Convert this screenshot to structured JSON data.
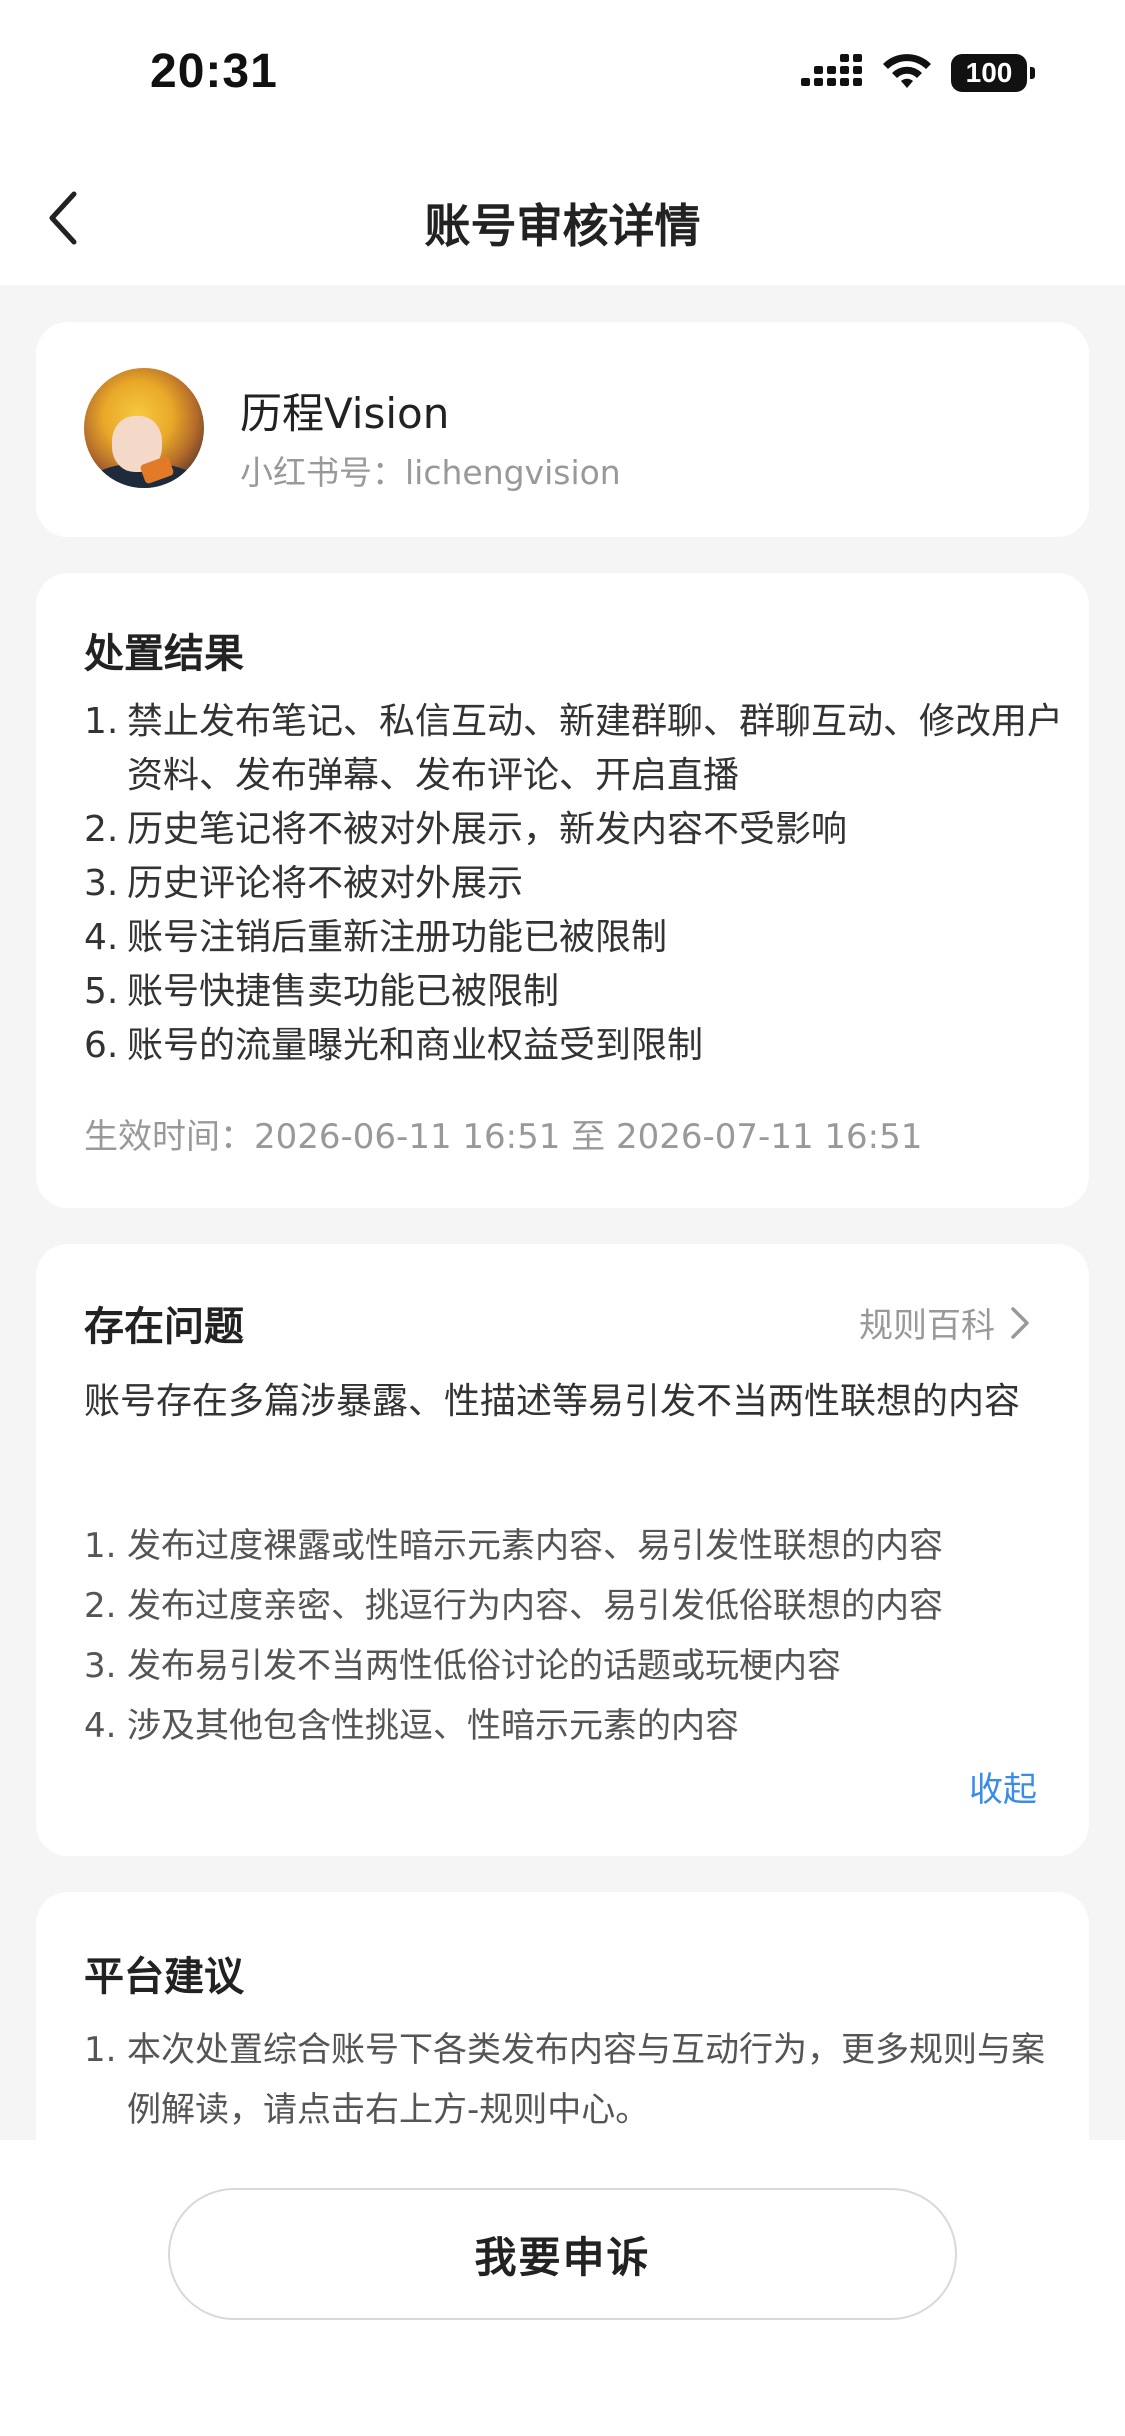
{
  "status_bar": {
    "time": "20:31",
    "battery": "100"
  },
  "header": {
    "title": "账号审核详情",
    "back_icon": "chevron-left-icon"
  },
  "profile": {
    "name": "历程Vision",
    "id_line": "小红书号：lichengvision"
  },
  "result": {
    "title": "处置结果",
    "items": [
      {
        "num": "1.",
        "text": "禁止发布笔记、私信互动、新建群聊、群聊互动、修改用户资料、发布弹幕、发布评论、开启直播"
      },
      {
        "num": "2.",
        "text": "历史笔记将不被对外展示，新发内容不受影响"
      },
      {
        "num": "3.",
        "text": "历史评论将不被对外展示"
      },
      {
        "num": "4.",
        "text": "账号注销后重新注册功能已被限制"
      },
      {
        "num": "5.",
        "text": "账号快捷售卖功能已被限制"
      },
      {
        "num": "6.",
        "text": "账号的流量曝光和商业权益受到限制"
      }
    ],
    "effective_time": "生效时间：2026-06-11 16:51 至 2026-07-11 16:51"
  },
  "problem": {
    "title": "存在问题",
    "rules_link": "规则百科",
    "summary": "账号存在多篇涉暴露、性描述等易引发不当两性联想的内容",
    "items": [
      {
        "num": "1.",
        "text": "发布过度裸露或性暗示元素内容、易引发性联想的内容"
      },
      {
        "num": "2.",
        "text": "发布过度亲密、挑逗行为内容、易引发低俗联想的内容"
      },
      {
        "num": "3.",
        "text": "发布易引发不当两性低俗讨论的话题或玩梗内容"
      },
      {
        "num": "4.",
        "text": "涉及其他包含性挑逗、性暗示元素的内容"
      }
    ],
    "collapse_label": "收起"
  },
  "advice": {
    "title": "平台建议",
    "items": [
      {
        "num": "1.",
        "text": "本次处置综合账号下各类发布内容与互动行为，更多规则与案例解读，请点击右上方-规则中心。"
      }
    ]
  },
  "bottom": {
    "appeal_label": "我要申诉"
  }
}
